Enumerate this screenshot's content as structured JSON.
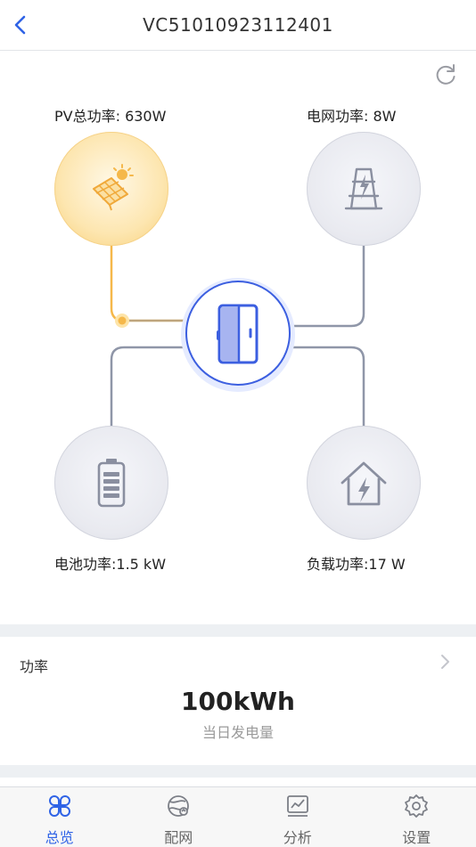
{
  "header": {
    "title": "VC51010923112401",
    "back_icon": "back-chevron-icon"
  },
  "refresh_icon": "refresh-icon",
  "flow": {
    "pv": {
      "label": "PV总功率: 630W",
      "icon": "solar-panel-icon"
    },
    "grid": {
      "label": "电网功率: 8W",
      "icon": "power-tower-icon"
    },
    "battery": {
      "label": "电池功率:1.5 kW",
      "icon": "battery-icon"
    },
    "load": {
      "label": "负载功率:17 W",
      "icon": "house-lightning-icon"
    },
    "hub_icon": "inverter-icon"
  },
  "power_card": {
    "title": "功率",
    "value": "100kWh",
    "caption": "当日发电量"
  },
  "tabs": [
    {
      "label": "总览",
      "icon": "overview-icon",
      "active": true
    },
    {
      "label": "配网",
      "icon": "network-icon",
      "active": false
    },
    {
      "label": "分析",
      "icon": "analysis-chart-icon",
      "active": false
    },
    {
      "label": "设置",
      "icon": "settings-gear-icon",
      "active": false
    }
  ],
  "colors": {
    "accent": "#2f63e6",
    "pv_active": "#f5b84a",
    "line": "#8f96a8",
    "hub_border": "#3c5fe0"
  }
}
